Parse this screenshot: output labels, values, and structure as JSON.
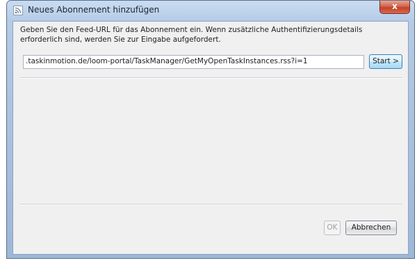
{
  "window": {
    "title": "Neues Abonnement hinzufügen",
    "close_label": "x"
  },
  "dialog": {
    "description": "Geben Sie den Feed-URL für das Abonnement ein. Wenn zusätzliche Authentifizierungsdetails erforderlich sind, werden Sie zur Eingabe aufgefordert.",
    "url_value": ".taskinmotion.de/loom-portal/TaskManager/GetMyOpenTaskInstances.rss?i=1",
    "start_label": "Start >",
    "ok_label": "OK",
    "cancel_label": "Abbrechen"
  },
  "colors": {
    "frame": "#b5cbe6",
    "client": "#f0f0f0",
    "close": "#c2412b"
  },
  "icons": {
    "app": "rss-feed-icon",
    "close": "close-icon"
  }
}
